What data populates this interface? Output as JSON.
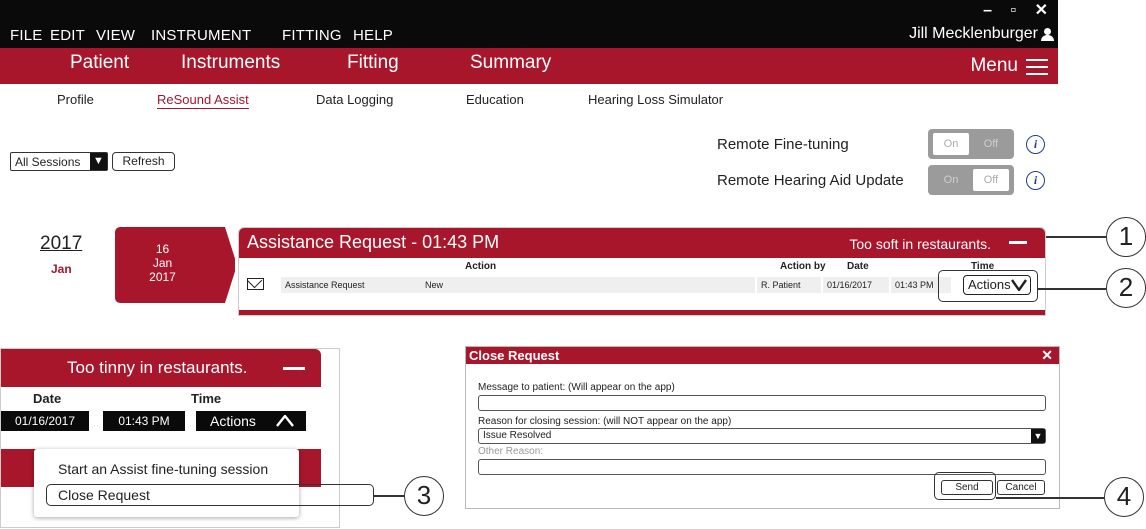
{
  "menubar": {
    "items": [
      "FILE",
      "EDIT",
      "VIEW",
      "INSTRUMENT",
      "FITTING",
      "HELP"
    ],
    "user_name": "Jill Mecklenburger",
    "window_controls": [
      "–",
      "▫",
      "✕"
    ]
  },
  "mainnav": {
    "tabs": [
      "Patient",
      "Instruments",
      "Fitting",
      "Summary"
    ],
    "menu_label": "Menu"
  },
  "subnav": {
    "tabs": [
      "Profile",
      "ReSound Assist",
      "Data Logging",
      "Education",
      "Hearing Loss Simulator"
    ],
    "active": "ReSound Assist"
  },
  "sessions": {
    "selected": "All Sessions",
    "refresh_label": "Refresh"
  },
  "remote": {
    "fine_tuning_label": "Remote Fine-tuning",
    "update_label": "Remote Hearing Aid Update",
    "on_label": "On",
    "off_label": "Off",
    "info_glyph": "i"
  },
  "timeline": {
    "year": "2017",
    "month": "Jan",
    "badge_day": "16",
    "badge_month": "Jan",
    "badge_year": "2017"
  },
  "request_panel": {
    "title": "Assistance Request - 01:43 PM",
    "complaint": "Too soft in restaurants.",
    "columns": {
      "action": "Action",
      "action_by": "Action by",
      "date": "Date",
      "time": "Time"
    },
    "row": {
      "type": "Assistance Request",
      "status": "New",
      "by": "R. Patient",
      "date": "01/16/2017",
      "time": "01:43 PM",
      "actions_label": "Actions"
    }
  },
  "inset": {
    "complaint": "Too tinny in restaurants.",
    "date_header": "Date",
    "time_header": "Time",
    "date": "01/16/2017",
    "time": "01:43 PM",
    "actions_label": "Actions",
    "menu_items": [
      "Start an Assist fine-tuning session",
      "Close Request"
    ]
  },
  "dialog": {
    "title": "Close Request",
    "close_glyph": "✕",
    "message_label": "Message to patient: (Will appear on the app)",
    "reason_label": "Reason for closing session: (will NOT appear on the app)",
    "reason_value": "Issue Resolved",
    "other_label": "Other Reason:",
    "send_label": "Send",
    "cancel_label": "Cancel"
  },
  "callouts": [
    "1",
    "2",
    "3",
    "4"
  ],
  "colors": {
    "brand_red": "#a8162b",
    "menubar_black": "#0a0a0a",
    "info_blue": "#1f3d8c"
  }
}
